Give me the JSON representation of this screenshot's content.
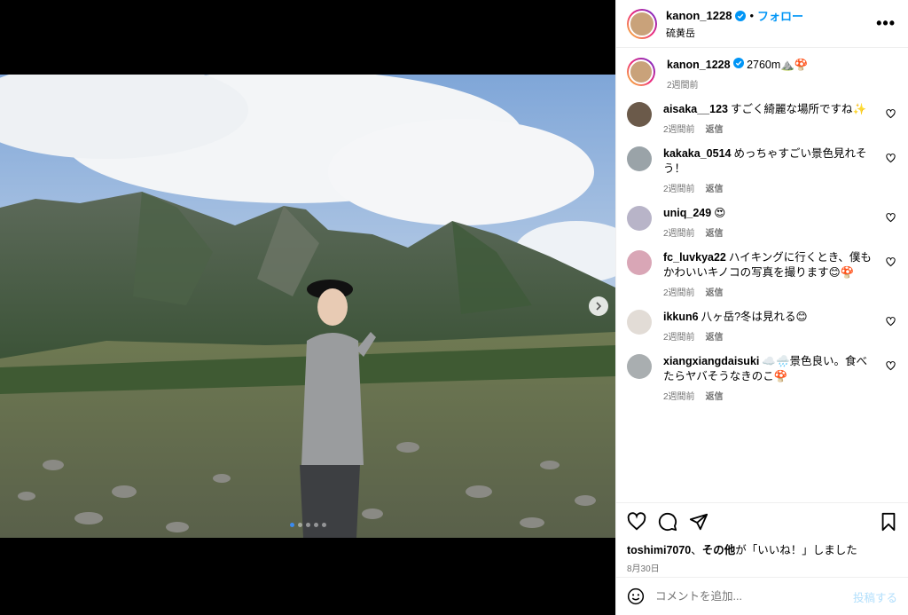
{
  "post": {
    "username": "kanon_1228",
    "follow_label": "フォロー",
    "separator": "•",
    "location": "硫黄岳",
    "more_label": "•••"
  },
  "caption": {
    "username": "kanon_1228",
    "text": "2760m⛰️🍄",
    "time": "2週間前"
  },
  "comments": [
    {
      "username": "aisaka__123",
      "text": "すごく綺麗な場所ですね✨",
      "time": "2週間前",
      "reply": "返信"
    },
    {
      "username": "kakaka_0514",
      "text": "めっちゃすごい景色見れそう！",
      "time": "2週間前",
      "reply": "返信"
    },
    {
      "username": "uniq_249",
      "text": "😍",
      "time": "2週間前",
      "reply": "返信"
    },
    {
      "username": "fc_luvkya22",
      "text": "ハイキングに行くとき、僕もかわいいキノコの写真を撮ります😊🍄",
      "time": "2週間前",
      "reply": "返信"
    },
    {
      "username": "ikkun6",
      "text": "八ヶ岳?冬は見れる😊",
      "time": "2週間前",
      "reply": "返信"
    },
    {
      "username": "xiangxiangdaisuki",
      "text": "☁️🌧️景色良い。食べたらヤバそうなきのこ🍄",
      "time": "2週間前",
      "reply": "返信"
    }
  ],
  "likes": {
    "user": "toshimi7070",
    "sep": "、",
    "others": "その他",
    "suffix": "が「いいね！」しました"
  },
  "date": "8月30日",
  "composer": {
    "placeholder": "コメントを追加...",
    "post_label": "投稿する"
  },
  "carousel": {
    "total": 5,
    "current": 1
  },
  "colors": {
    "accent": "#0095f6",
    "secondary_text": "#737373",
    "disabled_post": "#b2dffc"
  }
}
